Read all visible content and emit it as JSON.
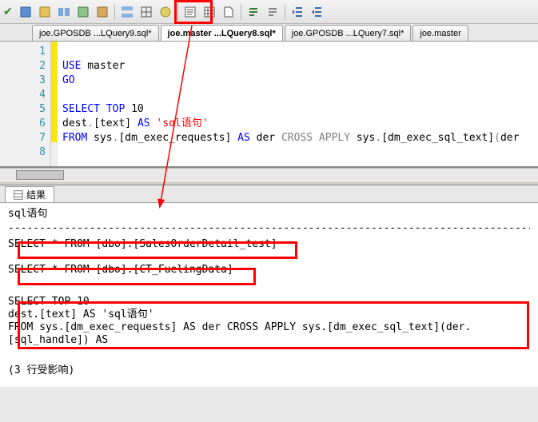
{
  "toolbar": {
    "icons": [
      "execute-icon",
      "debug-icon",
      "stop-icon",
      "parse-icon",
      "display-plan-icon",
      "include-plan-icon",
      "include-stats-icon",
      "sqlcmd-icon",
      "results-text-icon",
      "results-grid-icon",
      "results-file-icon",
      "comment-icon",
      "uncomment-icon",
      "indent-icon",
      "outdent-icon"
    ]
  },
  "tabs": {
    "t1": "joe.GPOSDB ...LQuery9.sql*",
    "t2": "joe.master ...LQuery8.sql*",
    "t3": "joe.GPOSDB ...LQuery7.sql*",
    "t4": "joe.master"
  },
  "editor": {
    "lines": [
      "1",
      "2",
      "3",
      "4",
      "5",
      "6",
      "7",
      "8"
    ],
    "l1_a": "USE",
    "l1_b": " master",
    "l2": "GO",
    "l4_a": "SELECT",
    "l4_b": " ",
    "l4_c": "TOP",
    "l4_d": " 10",
    "l5_a": "dest",
    "l5_b": ".",
    "l5_c": "[text] ",
    "l5_d": "AS",
    "l5_e": " ",
    "l5_f": "'sql语句'",
    "l6_a": "FROM",
    "l6_b": " ",
    "l6_c": "sys",
    "l6_d": ".",
    "l6_e": "[dm_exec_requests] ",
    "l6_f": "AS",
    "l6_g": " der ",
    "l6_h": "CROSS",
    "l6_i": " ",
    "l6_j": "APPLY",
    "l6_k": " ",
    "l6_l": "sys",
    "l6_m": ".",
    "l6_n": "[dm_exec_sql_text]",
    "l6_o": "(",
    "l6_p": "der"
  },
  "results": {
    "tab_label": "结果",
    "header": "sql语句",
    "dashes": "------------------------------------------------------------------------------------------------------------------------",
    "row1": "SELECT * FROM [dbo].[SalesOrderDetail_test]",
    "row2": "SELECT * FROM [dbo].[CT_FuelingData]",
    "row3_l1": "SELECT TOP 10",
    "row3_l2": "dest.[text] AS 'sql语句'",
    "row3_l3": "FROM sys.[dm_exec_requests] AS der CROSS APPLY sys.[dm_exec_sql_text](der.[sql_handle]) AS ",
    "footer": "(3 行受影响)"
  },
  "annotations": {
    "highlighted_toolbar_buttons": [
      "results-text-icon",
      "results-grid-icon"
    ],
    "red_boxes_target": [
      "toolbar-results-buttons",
      "result-row-1",
      "result-row-2",
      "result-row-3"
    ],
    "arrow": "from toolbar results-text button to results pane"
  }
}
